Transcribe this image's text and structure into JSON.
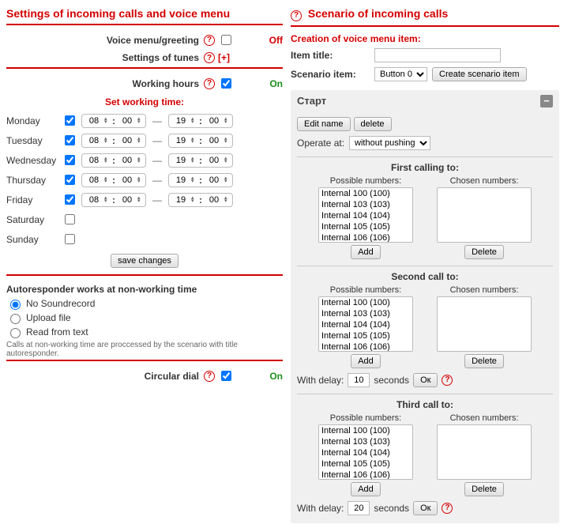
{
  "left": {
    "title": "Settings of incoming calls and voice menu",
    "voice_menu": {
      "label": "Voice menu/greeting",
      "state": "Off"
    },
    "tunes": {
      "label": "Settings of tunes",
      "plus": "[+]"
    },
    "working_hours": {
      "label": "Working hours",
      "state": "On"
    },
    "set_working_time": "Set working time:",
    "days": [
      {
        "name": "Monday",
        "checked": true,
        "from_h": "08",
        "from_m": "00",
        "to_h": "19",
        "to_m": "00"
      },
      {
        "name": "Tuesday",
        "checked": true,
        "from_h": "08",
        "from_m": "00",
        "to_h": "19",
        "to_m": "00"
      },
      {
        "name": "Wednesday",
        "checked": true,
        "from_h": "08",
        "from_m": "00",
        "to_h": "19",
        "to_m": "00"
      },
      {
        "name": "Thursday",
        "checked": true,
        "from_h": "08",
        "from_m": "00",
        "to_h": "19",
        "to_m": "00"
      },
      {
        "name": "Friday",
        "checked": true,
        "from_h": "08",
        "from_m": "00",
        "to_h": "19",
        "to_m": "00"
      },
      {
        "name": "Saturday",
        "checked": false
      },
      {
        "name": "Sunday",
        "checked": false
      }
    ],
    "save_changes": "save changes",
    "autoresponder": {
      "title": "Autoresponder works at non-working time",
      "options": [
        "No Soundrecord",
        "Upload file",
        "Read from text"
      ],
      "note": "Calls at non-working time are proccessed by the scenario with title autoresponder."
    },
    "circular_dial": {
      "label": "Circular dial",
      "state": "On"
    }
  },
  "right": {
    "title": "Scenario of incoming calls",
    "creation": {
      "heading": "Creation of voice menu item:",
      "item_title_label": "Item title:",
      "scenario_item_label": "Scenario item:",
      "scenario_select": "Button 0",
      "create_btn": "Create scenario item"
    },
    "panel": {
      "title": "Старт",
      "edit_name": "Edit name",
      "delete": "delete",
      "operate_at": {
        "label": "Operate at:",
        "value": "without pushing"
      },
      "calls": [
        {
          "title": "First calling to:",
          "poss_header": "Possible numbers:",
          "chosen_header": "Chosen numbers:",
          "numbers": [
            "Internal 100 (100)",
            "Internal 103 (103)",
            "Internal 104 (104)",
            "Internal 105 (105)",
            "Internal 106 (106)"
          ],
          "add": "Add",
          "del": "Delete"
        },
        {
          "title": "Second call to:",
          "poss_header": "Possible numbers:",
          "chosen_header": "Chosen numbers:",
          "numbers": [
            "Internal 100 (100)",
            "Internal 103 (103)",
            "Internal 104 (104)",
            "Internal 105 (105)",
            "Internal 106 (106)"
          ],
          "add": "Add",
          "del": "Delete",
          "delay": {
            "label": "With delay:",
            "value": "10",
            "seconds": "seconds",
            "ok": "Ок"
          }
        },
        {
          "title": "Third call to:",
          "poss_header": "Possible numbers:",
          "chosen_header": "Chosen numbers:",
          "numbers": [
            "Internal 100 (100)",
            "Internal 103 (103)",
            "Internal 104 (104)",
            "Internal 105 (105)",
            "Internal 106 (106)"
          ],
          "add": "Add",
          "del": "Delete",
          "delay": {
            "label": "With delay:",
            "value": "20",
            "seconds": "seconds",
            "ok": "Ок"
          }
        }
      ]
    }
  }
}
